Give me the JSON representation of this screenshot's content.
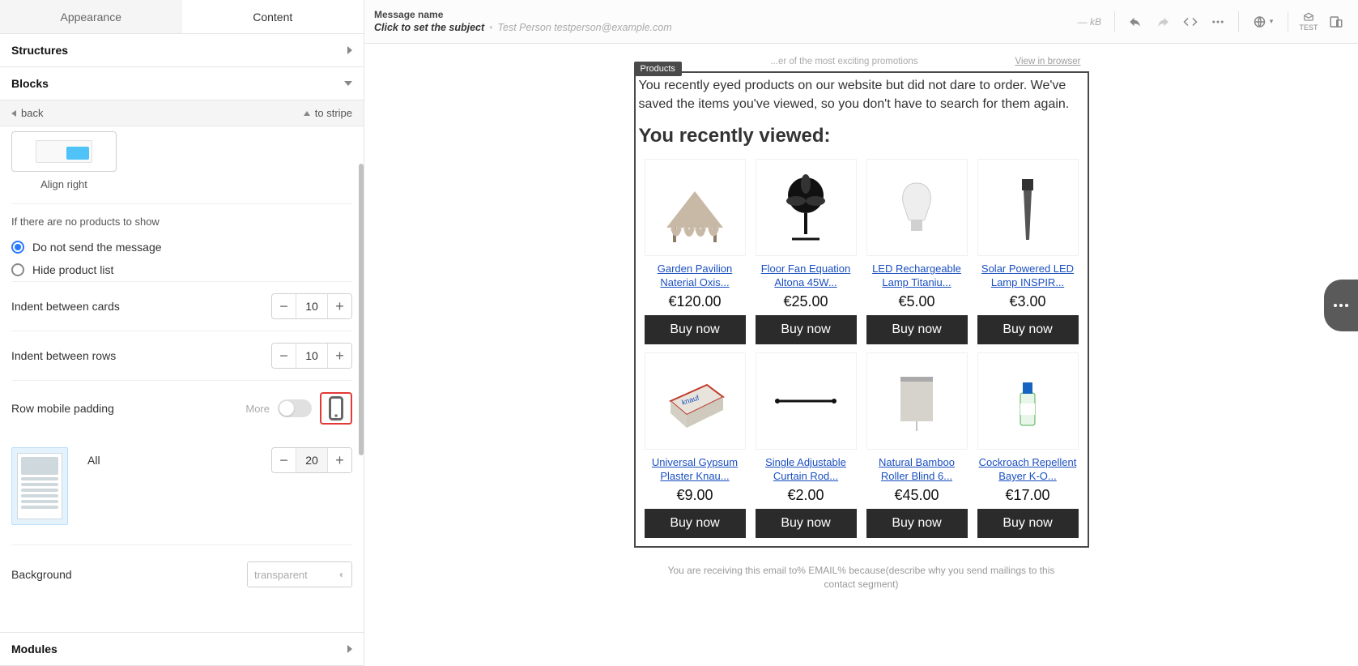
{
  "tabs": {
    "appearance": "Appearance",
    "content": "Content"
  },
  "sections": {
    "structures": "Structures",
    "blocks": "Blocks",
    "modules": "Modules"
  },
  "nav": {
    "back": "back",
    "to_stripe": "to stripe"
  },
  "align": {
    "caption": "Align right"
  },
  "noProducts": {
    "label": "If there are no products to show",
    "opt_do_not_send": "Do not send the message",
    "opt_hide": "Hide product list"
  },
  "controls": {
    "indent_cards": {
      "label": "Indent between cards",
      "value": "10"
    },
    "indent_rows": {
      "label": "Indent between rows",
      "value": "10"
    },
    "row_mobile": {
      "label": "Row mobile padding",
      "more": "More"
    },
    "padding_all": {
      "label": "All",
      "value": "20"
    },
    "background": {
      "label": "Background",
      "value": "transparent"
    }
  },
  "top": {
    "message_name": "Message name",
    "subject": "Click to set the subject",
    "from": "Test Person testperson@example.com",
    "kb": "— kB",
    "test": "TEST"
  },
  "email": {
    "promo_hint": "...er of the most exciting promotions",
    "view_in_browser": "View in browser",
    "badge": "Products",
    "intro": "You recently eyed products on our website but did not dare to order. We've saved the items you've viewed, so you don't have to search for them again.",
    "heading": "You recently viewed:",
    "buy_label": "Buy now",
    "footer": "You are receiving this email to% EMAIL% because(describe why you send mailings to this contact segment)",
    "products": [
      {
        "title": "Garden Pavilion Naterial Oxis...",
        "price": "€120.00",
        "icon": "pavilion"
      },
      {
        "title": "Floor Fan Equation Altona 45W...",
        "price": "€25.00",
        "icon": "fan"
      },
      {
        "title": "LED Rechargeable Lamp Titaniu...",
        "price": "€5.00",
        "icon": "bulb"
      },
      {
        "title": "Solar Powered LED Lamp INSPIR...",
        "price": "€3.00",
        "icon": "solar"
      },
      {
        "title": "Universal Gypsum Plaster Knau...",
        "price": "€9.00",
        "icon": "plaster"
      },
      {
        "title": "Single Adjustable Curtain Rod...",
        "price": "€2.00",
        "icon": "rod"
      },
      {
        "title": "Natural Bamboo Roller Blind 6...",
        "price": "€45.00",
        "icon": "blind"
      },
      {
        "title": "Cockroach Repellent Bayer K-O...",
        "price": "€17.00",
        "icon": "bottle"
      }
    ]
  }
}
